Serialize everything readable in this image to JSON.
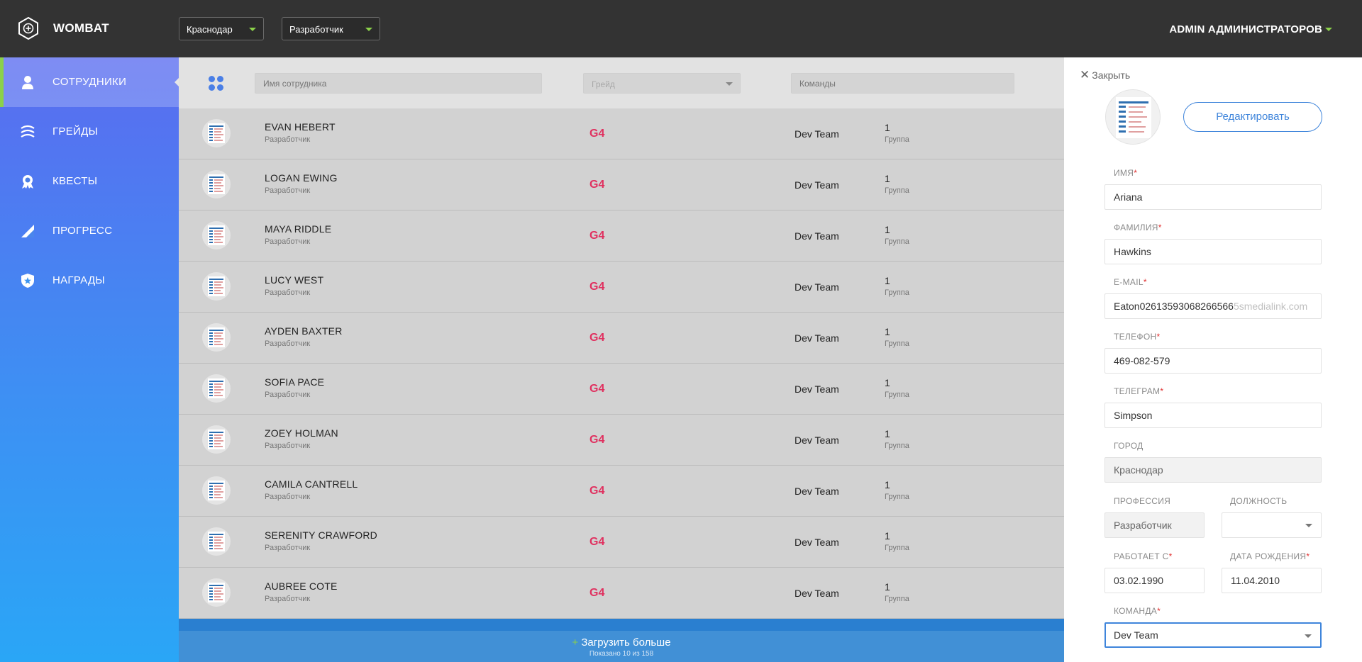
{
  "topbar": {
    "brand": "WOMBAT",
    "city_filter": "Краснодар",
    "profession_filter": "Разработчик",
    "user_name": "ADMIN АДМИНИСТРАТОРОВ"
  },
  "sidebar": {
    "items": [
      {
        "label": "СОТРУДНИКИ",
        "icon": "person-icon",
        "active": true
      },
      {
        "label": "ГРЕЙДЫ",
        "icon": "waves-icon",
        "active": false
      },
      {
        "label": "КВЕСТЫ",
        "icon": "medal-icon",
        "active": false
      },
      {
        "label": "ПРОГРЕСС",
        "icon": "progress-icon",
        "active": false
      },
      {
        "label": "НАГРАДЫ",
        "icon": "shield-star-icon",
        "active": false
      }
    ]
  },
  "filters": {
    "name_placeholder": "Имя сотрудника",
    "grade_placeholder": "Грейд",
    "teams_placeholder": "Команды"
  },
  "employees": [
    {
      "name": "EVAN HEBERT",
      "role": "Разработчик",
      "grade": "G4",
      "team": "Dev Team",
      "group_num": "1",
      "group_label": "Группа"
    },
    {
      "name": "LOGAN EWING",
      "role": "Разработчик",
      "grade": "G4",
      "team": "Dev Team",
      "group_num": "1",
      "group_label": "Группа"
    },
    {
      "name": "MAYA RIDDLE",
      "role": "Разработчик",
      "grade": "G4",
      "team": "Dev Team",
      "group_num": "1",
      "group_label": "Группа"
    },
    {
      "name": "LUCY WEST",
      "role": "Разработчик",
      "grade": "G4",
      "team": "Dev Team",
      "group_num": "1",
      "group_label": "Группа"
    },
    {
      "name": "AYDEN BAXTER",
      "role": "Разработчик",
      "grade": "G4",
      "team": "Dev Team",
      "group_num": "1",
      "group_label": "Группа"
    },
    {
      "name": "SOFIA PACE",
      "role": "Разработчик",
      "grade": "G4",
      "team": "Dev Team",
      "group_num": "1",
      "group_label": "Группа"
    },
    {
      "name": "ZOEY HOLMAN",
      "role": "Разработчик",
      "grade": "G4",
      "team": "Dev Team",
      "group_num": "1",
      "group_label": "Группа"
    },
    {
      "name": "CAMILA CANTRELL",
      "role": "Разработчик",
      "grade": "G4",
      "team": "Dev Team",
      "group_num": "1",
      "group_label": "Группа"
    },
    {
      "name": "SERENITY CRAWFORD",
      "role": "Разработчик",
      "grade": "G4",
      "team": "Dev Team",
      "group_num": "1",
      "group_label": "Группа"
    },
    {
      "name": "AUBREE COTE",
      "role": "Разработчик",
      "grade": "G4",
      "team": "Dev Team",
      "group_num": "1",
      "group_label": "Группа"
    }
  ],
  "load_more": {
    "plus": "+",
    "label": "Загрузить больше",
    "shown": "Показано 10 из 158"
  },
  "panel": {
    "close_label": "Закрыть",
    "edit_label": "Редактировать",
    "required_mark": "*",
    "first_name_label": "ИМЯ",
    "first_name": "Ariana",
    "last_name_label": "ФАМИЛИЯ",
    "last_name": "Hawkins",
    "email_label": "E-MAIL",
    "email_value": "Eaton02613593068266566",
    "email_overflow": "5smedialink.com",
    "phone_label": "ТЕЛЕФОН",
    "phone": "469-082-579",
    "telegram_label": "ТЕЛЕГРАМ",
    "telegram": "Simpson",
    "city_label": "ГОРОД",
    "city": "Краснодар",
    "profession_label": "ПРОФЕССИЯ",
    "profession": "Разработчик",
    "position_label": "ДОЛЖНОСТЬ",
    "position": "",
    "works_since_label": "РАБОТАЕТ С",
    "works_since": "03.02.1990",
    "birth_date_label": "ДАТА РОЖДЕНИЯ",
    "birth_date": "11.04.2010",
    "team_label": "КОМАНДА",
    "team": "Dev Team"
  },
  "colors": {
    "topbar": "#333333",
    "accent_green": "#8bd14a",
    "grade_pink": "#e0305f",
    "primary_blue": "#3f85db"
  }
}
